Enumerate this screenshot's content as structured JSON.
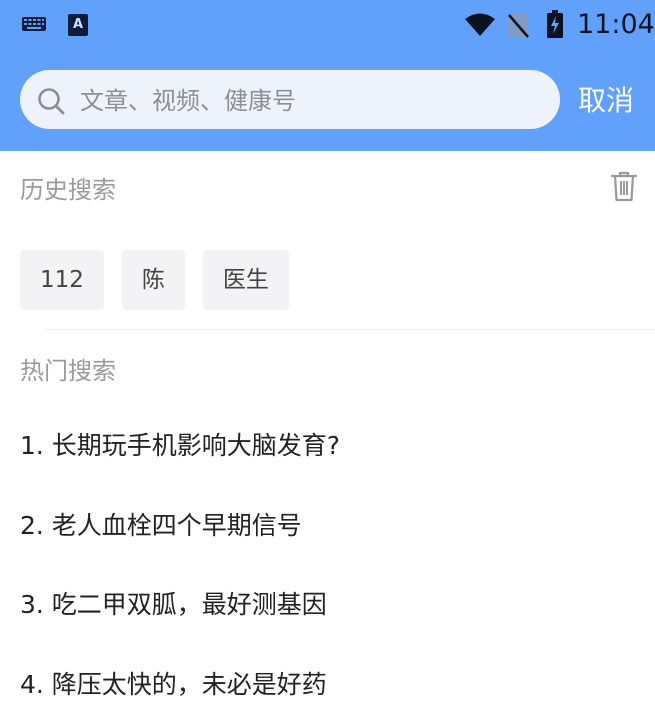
{
  "status_bar": {
    "time": "11:04",
    "icons": [
      "keyboard-icon",
      "a-icon",
      "wifi-icon",
      "no-sim-icon",
      "battery-charging-icon"
    ],
    "a_glyph": "A"
  },
  "search": {
    "placeholder": "文章、视频、健康号",
    "value": "",
    "cancel_label": "取消"
  },
  "history": {
    "title": "历史搜索",
    "items": [
      "112",
      "陈",
      "医生"
    ]
  },
  "hot": {
    "title": "热门搜索",
    "items": [
      "1. 长期玩手机影响大脑发育?",
      "2. 老人血栓四个早期信号",
      "3. 吃二甲双胍，最好测基因",
      "4. 降压太快的，未必是好药"
    ]
  },
  "colors": {
    "header": "#62a1fb",
    "search_box": "#eef3fb",
    "chip_bg": "#f3f3f5",
    "section_title": "#9a9a9a"
  }
}
